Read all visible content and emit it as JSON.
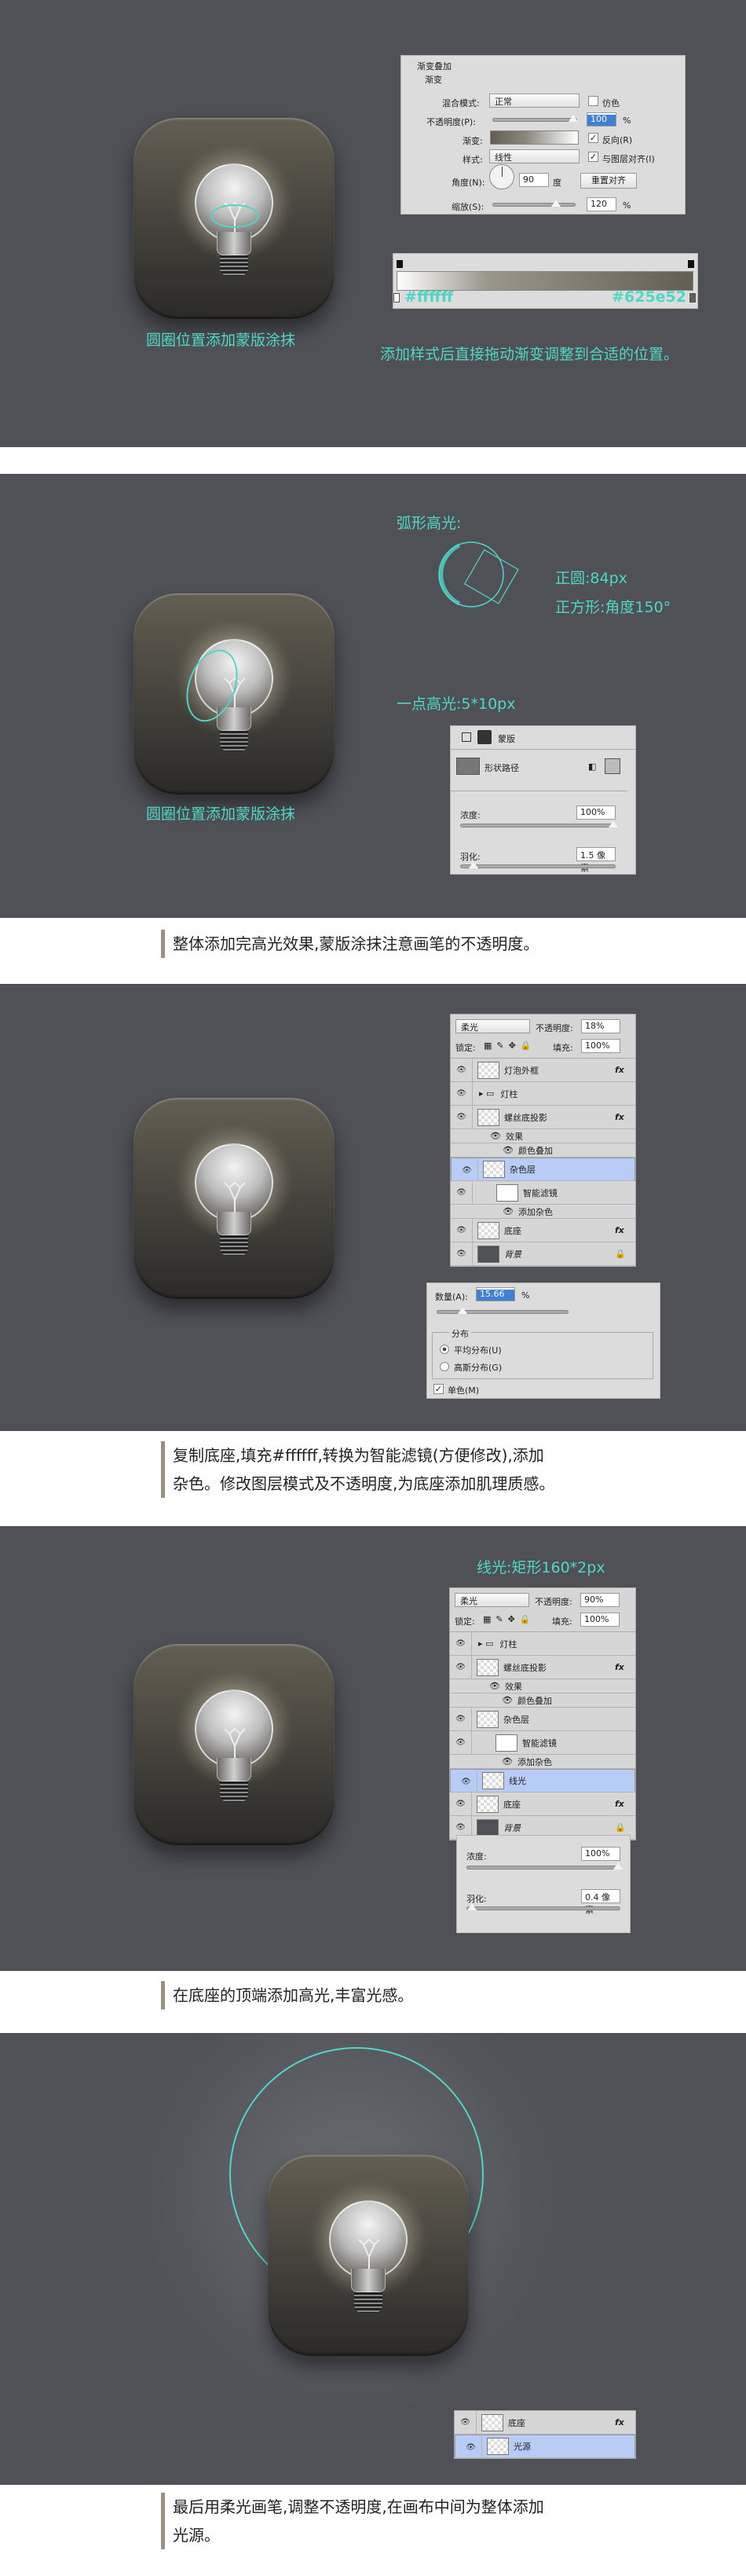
{
  "panel1": {
    "icon_caption": "圆圈位置添加蒙版涂抹",
    "gradient_dialog": {
      "title": "渐变叠加",
      "group": "渐变",
      "blend_label": "混合模式:",
      "blend_value": "正常",
      "dither_label": "仿色",
      "dither_checked": false,
      "opacity_label": "不透明度(P):",
      "opacity_value": "100",
      "percent": "%",
      "opacity_fraction": 1.0,
      "gradient_label": "渐变:",
      "reverse_label": "反向(R)",
      "reverse_checked": true,
      "style_label": "样式:",
      "style_value": "线性",
      "align_label": "与图层对齐(I)",
      "align_checked": true,
      "angle_label": "角度(N):",
      "angle_value": "90",
      "degree": "度",
      "reset_button": "重置对齐",
      "scale_label": "缩放(S):",
      "scale_value": "120",
      "scale_fraction": 0.75
    },
    "gradient_bar": {
      "left_color": "#ffffff",
      "right_color": "#625e52"
    },
    "instruction": "添加样式后直接拖动渐变调整到合适的位置。"
  },
  "panel2": {
    "arc_title": "弧形高光:",
    "circle_note": "正圆:84px",
    "square_note": "正方形:角度150°",
    "dot_title": "一点高光:5*10px",
    "icon_caption": "圆圈位置添加蒙版涂抹",
    "mask_panel": {
      "tab": "蒙版",
      "shape_label": "形状路径",
      "density_label": "浓度:",
      "density_value": "100%",
      "density_fraction": 1.0,
      "feather_label": "羽化:",
      "feather_value": "1.5 像素",
      "feather_fraction": 0.08
    }
  },
  "note1": "整体添加完高光效果,蒙版涂抹注意画笔的不透明度。",
  "panel3": {
    "layers": {
      "blend": "柔光",
      "opacity_label": "不透明度:",
      "opacity": "18%",
      "lock_label": "锁定:",
      "fill_label": "填充:",
      "fill": "100%",
      "rows": [
        {
          "name": "灯泡外框",
          "fx": "fx",
          "type": "layer"
        },
        {
          "name": "灯柱",
          "type": "group"
        },
        {
          "name": "螺丝底投影",
          "fx": "fx",
          "type": "layer"
        },
        {
          "name": "效果",
          "type": "sub"
        },
        {
          "name": "颜色叠加",
          "type": "sub2"
        },
        {
          "name": "杂色层",
          "type": "layer",
          "selected": true
        },
        {
          "name": "智能滤镜",
          "type": "filter"
        },
        {
          "name": "添加杂色",
          "type": "sub2"
        },
        {
          "name": "底座",
          "fx": "fx",
          "type": "layer"
        },
        {
          "name": "背景",
          "type": "bg"
        }
      ]
    },
    "noise": {
      "amount_label": "数量(A):",
      "amount_value": "15.66",
      "percent": "%",
      "amount_fraction": 0.19,
      "dist_label": "分布",
      "uniform": "平均分布(U)",
      "gaussian": "高斯分布(G)",
      "uniform_selected": true,
      "mono": "单色(M)",
      "mono_checked": true
    }
  },
  "note2": [
    "复制底座,填充#ffffff,转换为智能滤镜(方便修改),添加",
    "杂色。修改图层模式及不透明度,为底座添加肌理质感。"
  ],
  "panel4": {
    "title": "线光:矩形160*2px",
    "layers": {
      "blend": "柔光",
      "opacity_label": "不透明度:",
      "opacity": "90%",
      "lock_label": "锁定:",
      "fill_label": "填充:",
      "fill": "100%",
      "rows": [
        {
          "name": "灯柱",
          "type": "group"
        },
        {
          "name": "螺丝底投影",
          "fx": "fx",
          "type": "layer"
        },
        {
          "name": "效果",
          "type": "sub"
        },
        {
          "name": "颜色叠加",
          "type": "sub2"
        },
        {
          "name": "杂色层",
          "type": "layer"
        },
        {
          "name": "智能滤镜",
          "type": "filter"
        },
        {
          "name": "添加杂色",
          "type": "sub2"
        },
        {
          "name": "线光",
          "type": "layer",
          "selected": true
        },
        {
          "name": "底座",
          "fx": "fx",
          "type": "layer"
        },
        {
          "name": "背景",
          "type": "bg"
        }
      ]
    },
    "mask_panel": {
      "density_label": "浓度:",
      "density_value": "100%",
      "density_fraction": 1.0,
      "feather_label": "羽化:",
      "feather_value": "0.4 像素",
      "feather_fraction": 0.02
    }
  },
  "note3": "在底座的顶端添加高光,丰富光感。",
  "panel5": {
    "layers": {
      "rows": [
        {
          "name": "底座",
          "fx": "fx",
          "type": "layer"
        },
        {
          "name": "光源",
          "type": "layer",
          "selected": true
        }
      ]
    }
  },
  "note4": [
    "最后用柔光画笔,调整不透明度,在画布中间为整体添加",
    "光源。"
  ],
  "colors": {
    "accent": "#4fd6c6",
    "panel_bg": "#4f5157",
    "note_bar": "#9a9080"
  }
}
